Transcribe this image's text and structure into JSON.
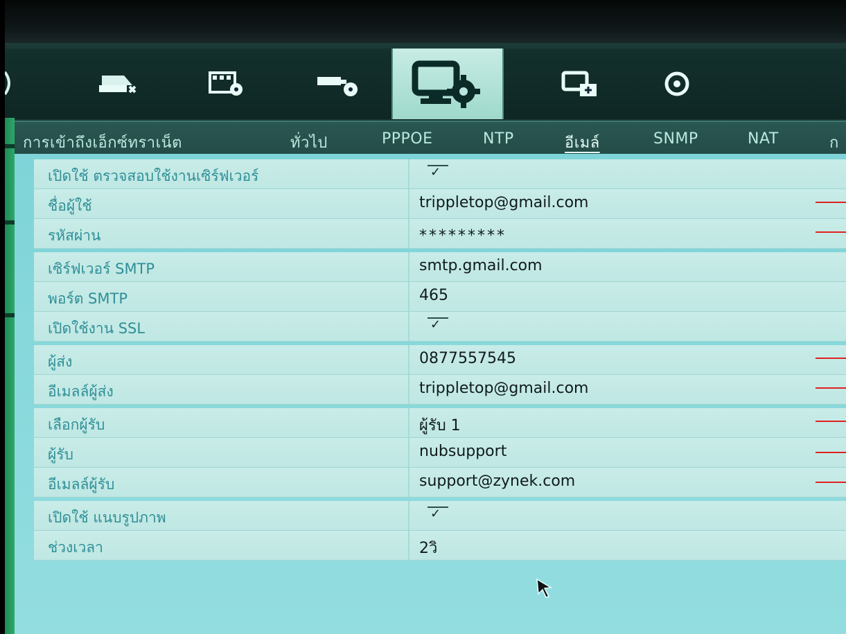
{
  "tabs": [
    {
      "label": "การเข้าถึงเอ็กซ์ทราเน็ต",
      "active": false
    },
    {
      "label": "ทั่วไป",
      "active": false
    },
    {
      "label": "PPPOE",
      "active": false
    },
    {
      "label": "NTP",
      "active": false
    },
    {
      "label": "อีเมล์",
      "active": true
    },
    {
      "label": "SNMP",
      "active": false
    },
    {
      "label": "NAT",
      "active": false
    },
    {
      "label": "ก",
      "active": false
    }
  ],
  "top_icons": [
    {
      "name": "network-drive-icon",
      "active": false
    },
    {
      "name": "video-settings-icon",
      "active": false
    },
    {
      "name": "camera-settings-icon",
      "active": false
    },
    {
      "name": "system-settings-icon",
      "active": true
    },
    {
      "name": "device-management-icon",
      "active": false
    },
    {
      "name": "power-icon",
      "active": false
    }
  ],
  "form": {
    "enable_server_auth": {
      "label": "เปิดใช้ ตรวจสอบใช้งานเซิร์ฟเวอร์",
      "checked": true
    },
    "username": {
      "label": "ชื่อผู้ใช้",
      "value": "trippletop@gmail.com"
    },
    "password": {
      "label": "รหัสผ่าน",
      "value": "*********"
    },
    "smtp_server": {
      "label": "เซิร์ฟเวอร์ SMTP",
      "value": "smtp.gmail.com"
    },
    "smtp_port": {
      "label": "พอร์ต SMTP",
      "value": "465"
    },
    "enable_ssl": {
      "label": "เปิดใช้งาน SSL",
      "checked": true
    },
    "sender": {
      "label": "ผู้ส่ง",
      "value": "0877557545"
    },
    "sender_email": {
      "label": "อีเมลล์ผู้ส่ง",
      "value": "trippletop@gmail.com"
    },
    "select_recipient": {
      "label": "เลือกผู้รับ",
      "value": "ผู้รับ 1"
    },
    "recipient": {
      "label": "ผู้รับ",
      "value": "nubsupport"
    },
    "recipient_email": {
      "label": "อีเมลล์ผู้รับ",
      "value": "support@zynek.com"
    },
    "enable_attachment": {
      "label": "เปิดใช้ แนบรูปภาพ",
      "checked": true
    },
    "interval": {
      "label": "ช่วงเวลา",
      "value": "2วิ"
    }
  },
  "check_glyph": "✓"
}
